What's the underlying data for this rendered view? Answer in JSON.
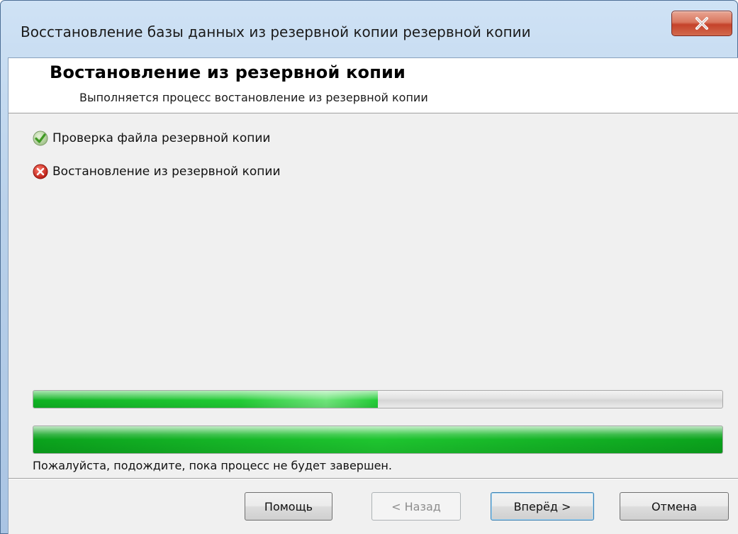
{
  "window": {
    "title": "Восстановление базы данных из резервной копии резервной копии",
    "close_label": "X"
  },
  "header": {
    "title": "Востановление из резервной копии",
    "subtitle": "Выполняется процесс востановление из резервной копии"
  },
  "steps": [
    {
      "label": "Проверка файла резервной копии",
      "state": "success",
      "icon": "check-icon"
    },
    {
      "label": "Востановление из резервной копии",
      "state": "error",
      "icon": "error-icon"
    }
  ],
  "progress": {
    "current_fraction": 0.5,
    "overall_fraction": 1.0,
    "status": "Пожалуйста, подождите, пока процесс не будет завершен."
  },
  "buttons": {
    "help": "Помощь",
    "back": "< Назад",
    "next": "Вперёд >",
    "cancel": "Отмена"
  },
  "colors": {
    "progress_green": "#1ec52f",
    "success_green": "#4caf3a",
    "error_red": "#d9271e"
  }
}
